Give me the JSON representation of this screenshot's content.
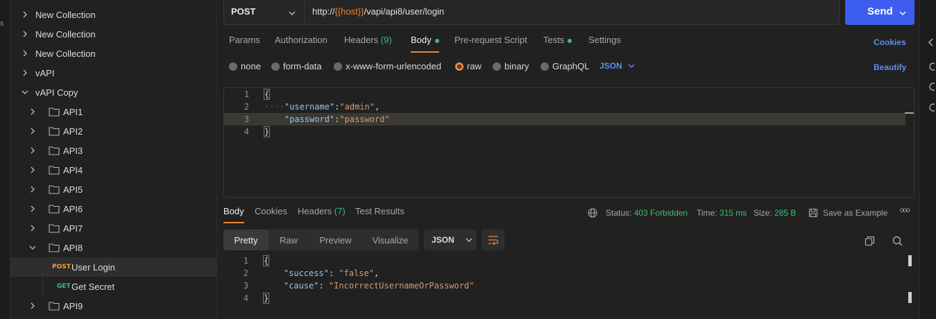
{
  "left_rail": {
    "text": "s"
  },
  "sidebar": {
    "rows": [
      {
        "label": "New Collection",
        "level": 0,
        "expanded": false
      },
      {
        "label": "New Collection",
        "level": 0,
        "expanded": false
      },
      {
        "label": "New Collection",
        "level": 0,
        "expanded": false
      },
      {
        "label": "vAPI",
        "level": 0,
        "expanded": false
      },
      {
        "label": "vAPI Copy",
        "level": 0,
        "expanded": true
      },
      {
        "label": "API1",
        "level": 1,
        "expanded": false
      },
      {
        "label": "API2",
        "level": 1,
        "expanded": false
      },
      {
        "label": "API3",
        "level": 1,
        "expanded": false
      },
      {
        "label": "API4",
        "level": 1,
        "expanded": false
      },
      {
        "label": "API5",
        "level": 1,
        "expanded": false
      },
      {
        "label": "API6",
        "level": 1,
        "expanded": false
      },
      {
        "label": "API7",
        "level": 1,
        "expanded": false
      },
      {
        "label": "API8",
        "level": 1,
        "expanded": true
      },
      {
        "label": "User Login",
        "level": 2,
        "method": "POST",
        "selected": true
      },
      {
        "label": "Get Secret",
        "level": 2,
        "method": "GET"
      },
      {
        "label": "API9",
        "level": 1,
        "expanded": false
      }
    ]
  },
  "request": {
    "method": "POST",
    "url_prefix": "http://",
    "url_var": "{{host}}",
    "url_suffix": "/vapi/api8/user/login",
    "send_label": "Send"
  },
  "req_tabs": {
    "params": "Params",
    "authorization": "Authorization",
    "headers": "Headers",
    "headers_count": "(9)",
    "body": "Body",
    "prerequest": "Pre-request Script",
    "tests": "Tests",
    "settings": "Settings",
    "cookies": "Cookies"
  },
  "body_types": {
    "none": "none",
    "form_data": "form-data",
    "urlencoded": "x-www-form-urlencoded",
    "raw": "raw",
    "binary": "binary",
    "graphql": "GraphQL",
    "format": "JSON",
    "beautify": "Beautify"
  },
  "request_body": {
    "line_numbers": [
      "1",
      "2",
      "3",
      "4"
    ],
    "open_brace": "{",
    "close_brace": "}",
    "k1": "\"username\"",
    "v1": "\"admin\"",
    "k2": "\"password\"",
    "v2": "\"password\"",
    "colon": ":",
    "comma": ","
  },
  "response": {
    "tabs": {
      "body": "Body",
      "cookies": "Cookies",
      "headers": "Headers",
      "headers_count": "(7)",
      "test_results": "Test Results"
    },
    "status_label": "Status:",
    "status_value": "403 Forbidden",
    "time_label": "Time:",
    "time_value": "315 ms",
    "size_label": "Size:",
    "size_value": "285 B",
    "save_example": "Save as Example",
    "more": "ooo",
    "views": {
      "pretty": "Pretty",
      "raw": "Raw",
      "preview": "Preview",
      "visualize": "Visualize"
    },
    "format": "JSON",
    "line_numbers": [
      "1",
      "2",
      "3",
      "4"
    ],
    "open_brace": "{",
    "close_brace": "}",
    "k1": "\"success\"",
    "v1": "\"false\"",
    "k2": "\"cause\"",
    "v2": "\"IncorrectUsernameOrPassword\"",
    "colon": ": ",
    "comma": ","
  },
  "colors": {
    "accent": "#e8863a",
    "send": "#3d5dee",
    "link": "#5c8cf2",
    "success": "#3fbf72"
  }
}
